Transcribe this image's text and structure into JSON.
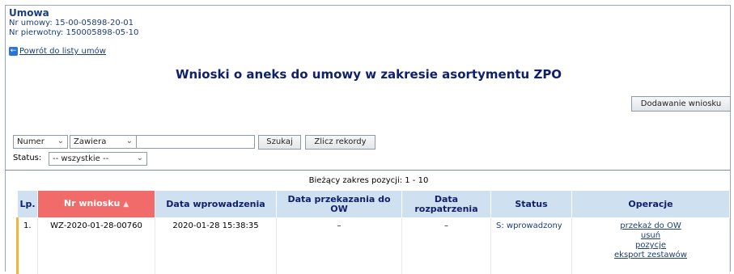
{
  "header": {
    "umowa_title": "Umowa",
    "nr_umowy": "Nr umowy: 15-00-05898-20-01",
    "nr_pierwotny": "Nr pierwotny: 150005898-05-10",
    "back_link": "Powrót do listy umów"
  },
  "page_title": "Wnioski o aneks do umowy w zakresie asortymentu ZPO",
  "toolbar": {
    "add_button": "Dodawanie wniosku"
  },
  "filters": {
    "field_select": "Numer",
    "operator_select": "Zawiera",
    "search_value": "",
    "search_button": "Szukaj",
    "count_button": "Zlicz rekordy",
    "status_label": "Status:",
    "status_select": "-- wszystkie --"
  },
  "range_text": "Bieżący zakres pozycji: 1 - 10",
  "table": {
    "columns": [
      "Lp.",
      "Nr wniosku",
      "Data wprowadzenia",
      "Data przekazania do OW",
      "Data rozpatrzenia",
      "Status",
      "Operacje"
    ],
    "rows": [
      {
        "lp": "1.",
        "nr": "WZ-2020-01-28-00760",
        "data_wprowadzenia": "2020-01-28 15:38:35",
        "data_przekazania": "–",
        "data_rozpatrzenia": "–",
        "status": "S: wprowadzony",
        "operations": [
          "przekaż do OW",
          "usuń",
          "pozycje",
          "eksport zestawów"
        ]
      }
    ]
  },
  "colors": {
    "header_bg": "#cfe0f0",
    "sorted_header_bg": "#f26b6b",
    "title_color": "#10206a",
    "row_marker": "#f2b43a"
  }
}
